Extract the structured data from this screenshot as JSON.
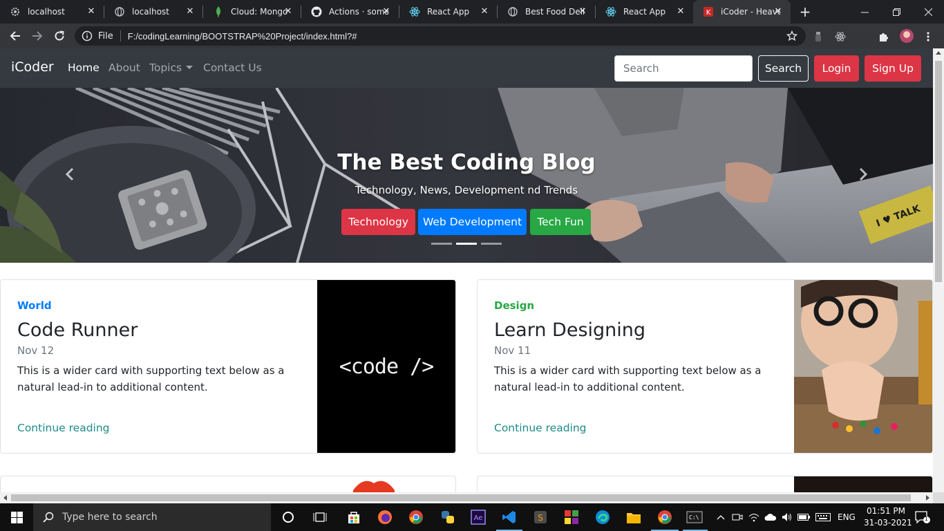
{
  "browser": {
    "tabs": [
      {
        "label": "localhost",
        "icon": "gear-icon",
        "active": false
      },
      {
        "label": "localhost",
        "icon": "globe-icon",
        "active": false
      },
      {
        "label": "Cloud: Mongo",
        "icon": "mongodb-leaf-icon",
        "active": false
      },
      {
        "label": "Actions · soma",
        "icon": "github-icon",
        "active": false
      },
      {
        "label": "React App",
        "icon": "react-icon",
        "active": false
      },
      {
        "label": "Best Food Deli",
        "icon": "globe-icon",
        "active": false
      },
      {
        "label": "React App",
        "icon": "react-icon",
        "active": false
      },
      {
        "label": "iCoder - Heave",
        "icon": "icoder-icon",
        "active": true
      }
    ],
    "address": {
      "scheme_label": "File",
      "url": "F:/codingLearning/BOOTSTRAP%20Project/index.html?#"
    }
  },
  "site": {
    "brand": "iCoder",
    "nav": {
      "home": "Home",
      "about": "About",
      "topics": "Topics",
      "contact": "Contact Us"
    },
    "search": {
      "placeholder": "Search",
      "button": "Search"
    },
    "login": "Login",
    "signup": "Sign Up",
    "colors": {
      "navbar": "#343a40",
      "danger": "#dc3545",
      "primary": "#007bff",
      "success": "#28a745",
      "link": "#1e8a8a"
    }
  },
  "carousel": {
    "title": "The Best Coding Blog",
    "subtitle": "Technology, News, Development nd Trends",
    "buttons": {
      "technology": "Technology",
      "webdev": "Web Development",
      "techfun": "Tech Fun"
    },
    "active_slide": 2,
    "slide_count": 3
  },
  "cards": [
    {
      "category": "World",
      "title": "Code Runner",
      "date": "Nov 12",
      "text": "This is a wider card with supporting text below as a natural lead-in to additional content.",
      "link": "Continue reading",
      "image_text": "<code />"
    },
    {
      "category": "Design",
      "title": "Learn Designing",
      "date": "Nov 11",
      "text": "This is a wider card with supporting text below as a natural lead-in to additional content.",
      "link": "Continue reading"
    }
  ],
  "taskbar": {
    "search_placeholder": "Type here to search",
    "language": "ENG",
    "time": "01:51 PM",
    "date": "31-03-2021",
    "notification_count": "1"
  }
}
